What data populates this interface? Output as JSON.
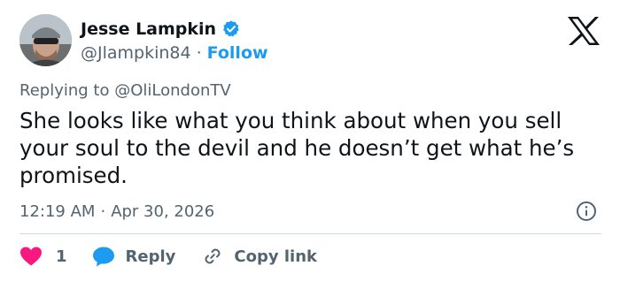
{
  "author": {
    "display_name": "Jesse Lampkin",
    "handle": "@Jlampkin84",
    "separator": "·",
    "follow_label": "Follow"
  },
  "reply_context": {
    "prefix": "Replying to",
    "mention": "@OliLondonTV"
  },
  "tweet": {
    "text": "She looks like what you think about when you sell your soul to the devil and he doesn’t get what he’s promised."
  },
  "meta": {
    "time": "12:19 AM",
    "separator": "·",
    "date": "Apr 30, 2026"
  },
  "actions": {
    "like_count": "1",
    "reply_label": "Reply",
    "copy_link_label": "Copy link"
  },
  "icons": {
    "verified": "verified-badge-icon",
    "logo": "x-logo-icon",
    "info": "info-icon",
    "like": "heart-icon",
    "reply": "speech-bubble-icon",
    "copy": "link-icon"
  },
  "colors": {
    "text": "#0f1419",
    "secondary": "#536471",
    "accent": "#1d9bf0",
    "like": "#f91880",
    "divider": "#cfd9de"
  }
}
